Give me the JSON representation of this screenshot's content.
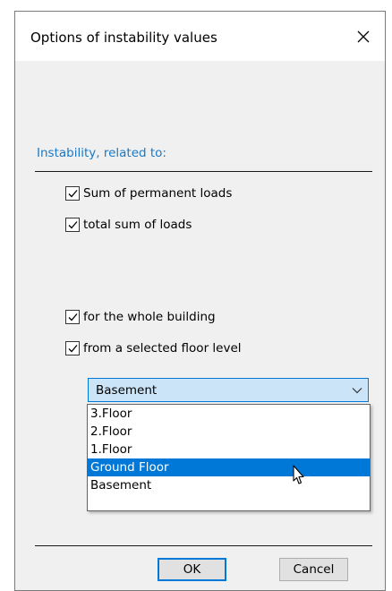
{
  "window": {
    "title": "Options of instability values"
  },
  "section": {
    "label": "Instability, related to:"
  },
  "checkboxes": [
    {
      "label": "Sum of permanent loads",
      "checked": true
    },
    {
      "label": "total sum of loads",
      "checked": true
    },
    {
      "label": "for the whole building",
      "checked": true
    },
    {
      "label": "from a selected floor level",
      "checked": true
    }
  ],
  "floor_select": {
    "value": "Basement",
    "options": [
      "3.Floor",
      "2.Floor",
      "1.Floor",
      "Ground Floor",
      "Basement"
    ],
    "highlighted": "Ground Floor"
  },
  "buttons": {
    "ok": "OK",
    "cancel": "Cancel"
  },
  "colors": {
    "accent": "#0078d7",
    "section_label": "#1b78c4",
    "combo_bg": "#cce4f7",
    "dialog_bg": "#f0f0f0"
  }
}
